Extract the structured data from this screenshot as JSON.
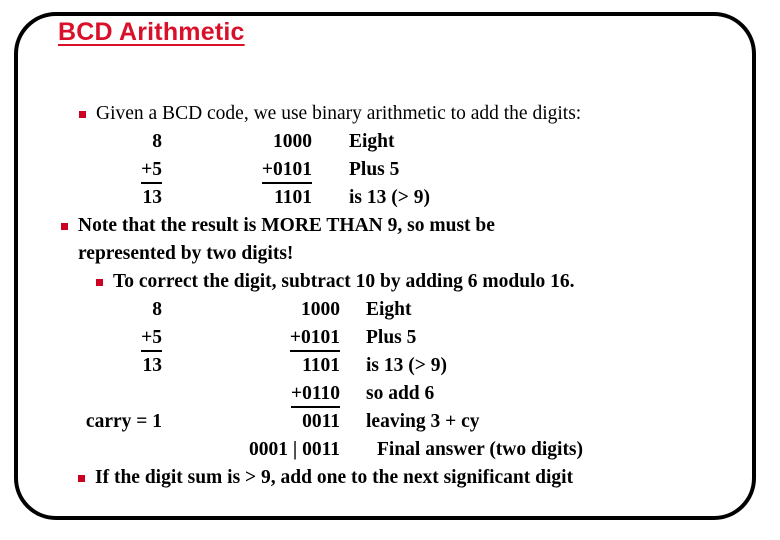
{
  "slide": {
    "title": "BCD Arithmetic",
    "title_color": "#d9102a",
    "bullet_color": "#cc0022",
    "border_color": "#000000",
    "background_color": "#ffffff"
  },
  "bullets": {
    "b1": "Given a BCD code, we use binary arithmetic to add the digits:",
    "b2_line1": "Note that the result is MORE THAN 9, so must be",
    "b2_line2": "represented by two digits!",
    "b3": "To correct the digit, subtract 10 by adding 6 modulo 16.",
    "b4": "If the digit sum is > 9, add one to the next significant digit"
  },
  "block1": {
    "rows": [
      {
        "decimal": "8",
        "binary": "1000",
        "note": "Eight",
        "dec_underline": false,
        "bin_underline": false
      },
      {
        "decimal": "+5",
        "binary": "+0101",
        "note": "Plus 5",
        "dec_underline": true,
        "bin_underline": true
      },
      {
        "decimal": "13",
        "binary": "1101",
        "note": "is 13 (> 9)",
        "dec_underline": false,
        "bin_underline": false
      }
    ]
  },
  "block2": {
    "rows": [
      {
        "decimal": "8",
        "binary": "1000",
        "note": "Eight",
        "dec_underline": false,
        "bin_underline": false,
        "note_indent": false
      },
      {
        "decimal": "+5",
        "binary": "+0101",
        "note": "Plus 5",
        "dec_underline": true,
        "bin_underline": true,
        "note_indent": false
      },
      {
        "decimal": "13",
        "binary": "1101",
        "note": "is 13 (> 9)",
        "dec_underline": false,
        "bin_underline": false,
        "note_indent": false
      },
      {
        "decimal": "",
        "binary": "+0110",
        "note": "so add 6",
        "dec_underline": false,
        "bin_underline": true,
        "note_indent": false
      },
      {
        "decimal": "carry = 1",
        "binary": "0011",
        "note": "leaving 3 + cy",
        "dec_underline": false,
        "bin_underline": false,
        "note_indent": false
      },
      {
        "decimal": "",
        "binary": "0001 | 0011",
        "note": "Final answer (two digits)",
        "dec_underline": false,
        "bin_underline": false,
        "note_indent": true
      }
    ]
  }
}
